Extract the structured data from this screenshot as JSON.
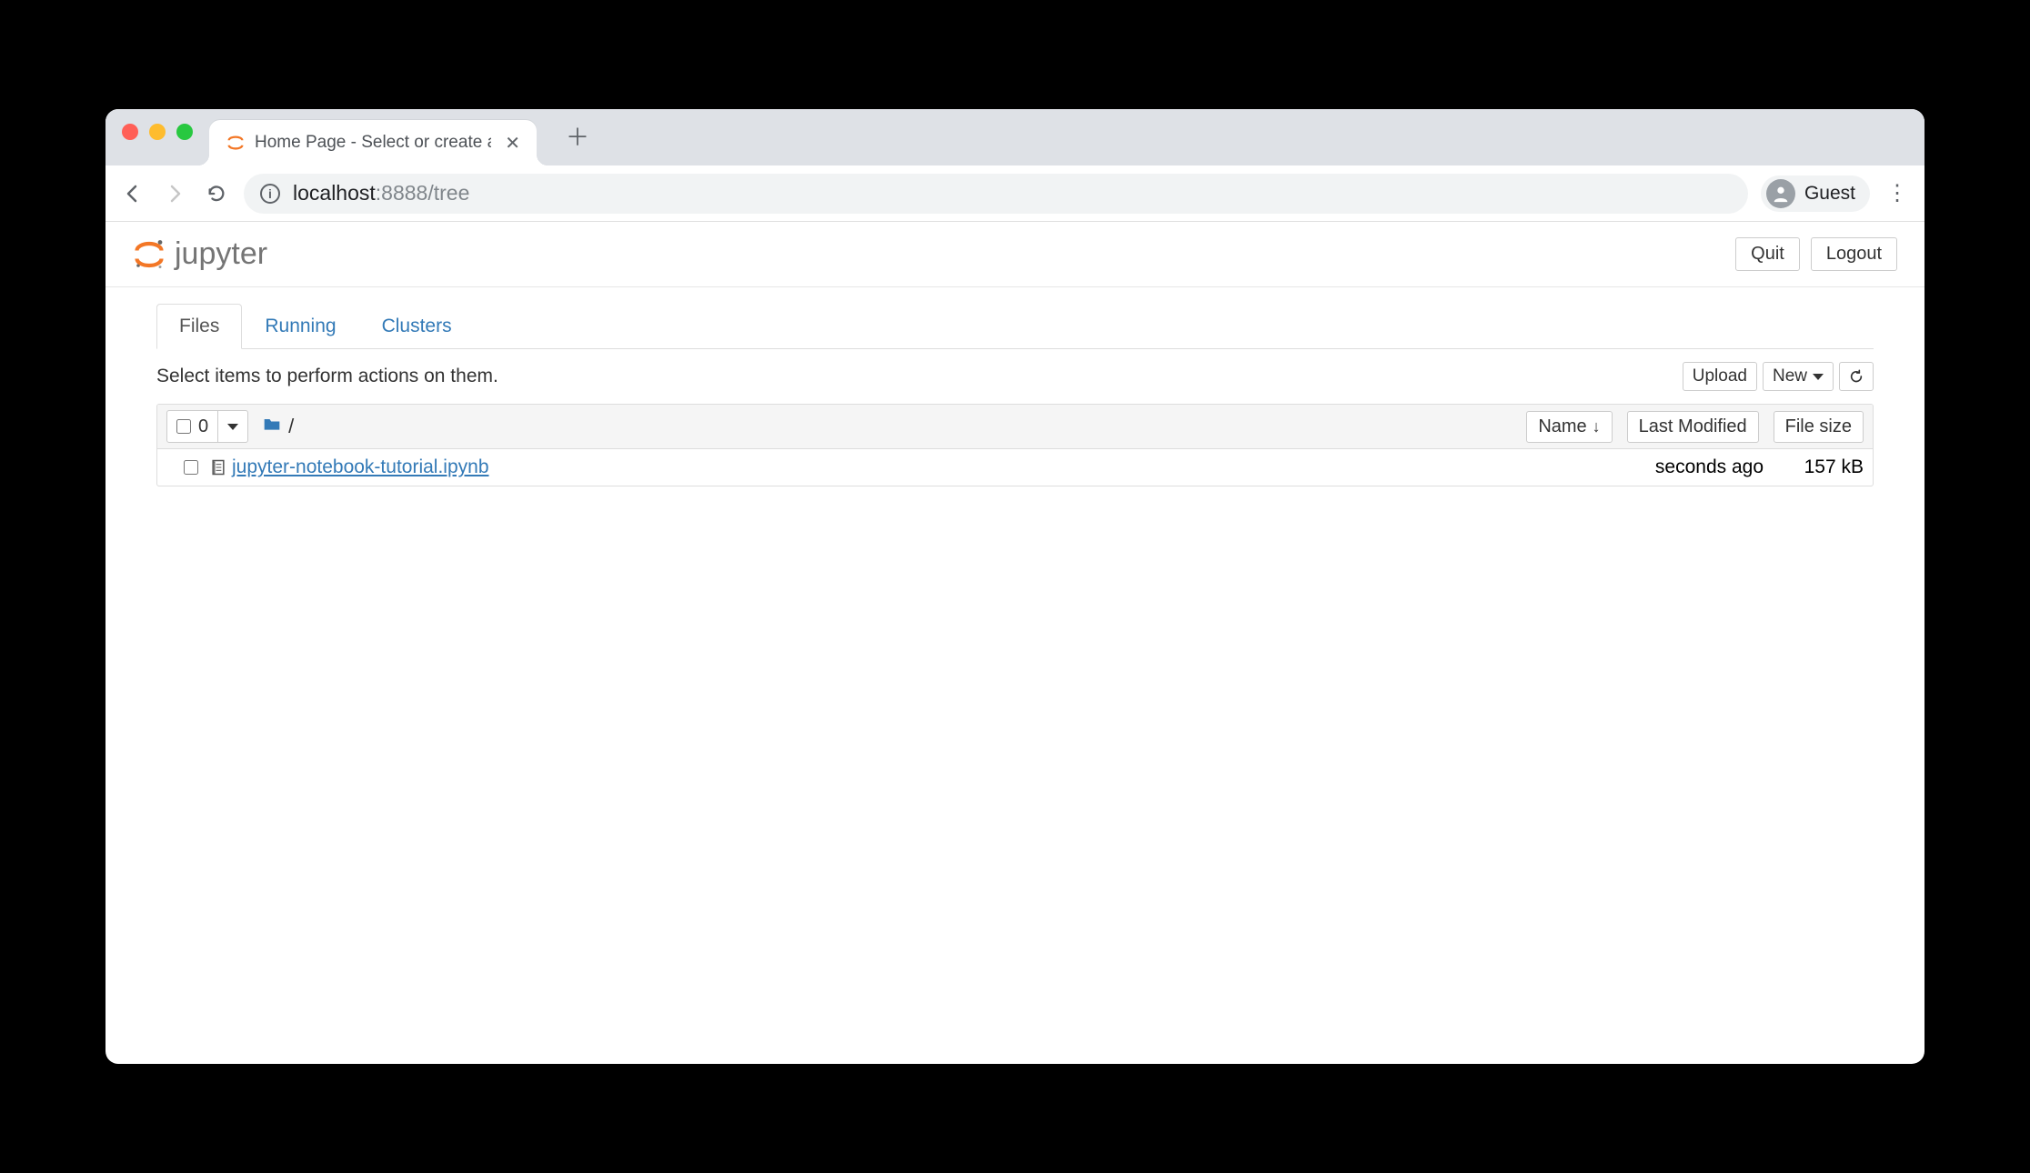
{
  "browser": {
    "tab_title": "Home Page - Select or create a n",
    "url_host": "localhost",
    "url_port_path": ":8888/tree",
    "profile_label": "Guest"
  },
  "header": {
    "brand": "jupyter",
    "quit_label": "Quit",
    "logout_label": "Logout"
  },
  "tabs": {
    "files": "Files",
    "running": "Running",
    "clusters": "Clusters"
  },
  "actions": {
    "instruction": "Select items to perform actions on them.",
    "upload_label": "Upload",
    "new_label": "New"
  },
  "listing": {
    "select_count": "0",
    "breadcrumb_root": "/",
    "sort": {
      "name": "Name",
      "modified": "Last Modified",
      "size": "File size"
    },
    "rows": [
      {
        "name": "jupyter-notebook-tutorial.ipynb",
        "modified": "seconds ago",
        "size": "157 kB"
      }
    ]
  }
}
